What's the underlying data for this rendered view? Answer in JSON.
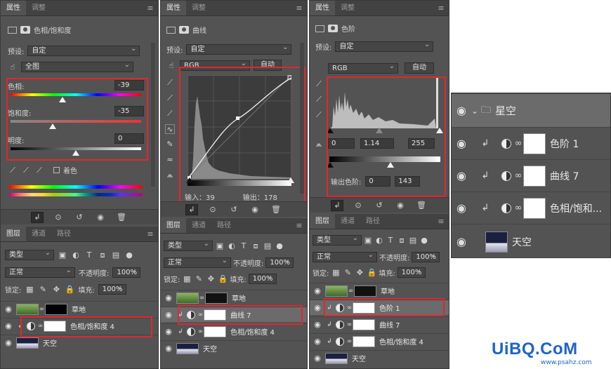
{
  "tabs": {
    "properties": "属性",
    "adjustments": "调整",
    "layers": "图层",
    "channels": "通道",
    "paths": "路径",
    "menu": "≡"
  },
  "p1": {
    "title": "色相/饱和度",
    "preset_label": "预设:",
    "preset_value": "自定",
    "channel_value": "全图",
    "hue_label": "色相:",
    "hue_value": "-39",
    "hue_pos": 0.4,
    "sat_label": "饱和度:",
    "sat_value": "-35",
    "sat_pos": 0.32,
    "light_label": "明度:",
    "light_value": "0",
    "light_pos": 0.5,
    "colorize_label": "着色",
    "layers": {
      "kind": "类型",
      "blend": "正常",
      "opacity_label": "不透明度:",
      "opacity_value": "100%",
      "lock_label": "锁定:",
      "fill_label": "填充:",
      "fill_value": "100%",
      "rows": [
        {
          "name": "草地"
        },
        {
          "name": "色相/饱和度 4"
        },
        {
          "name": "天空"
        }
      ]
    }
  },
  "p2": {
    "title": "曲线",
    "preset_label": "预设:",
    "preset_value": "自定",
    "channel_value": "RGB",
    "auto_label": "自动",
    "input_label": "输入：39",
    "output_label": "输出：178",
    "layers": {
      "kind": "类型",
      "blend": "正常",
      "opacity_label": "不透明度:",
      "opacity_value": "100%",
      "lock_label": "锁定:",
      "fill_label": "填充:",
      "fill_value": "100%",
      "rows": [
        {
          "name": "草地"
        },
        {
          "name": "曲线 7"
        },
        {
          "name": "色相/饱和度 4"
        },
        {
          "name": "天空"
        }
      ]
    }
  },
  "p3": {
    "title": "色阶",
    "preset_label": "预设:",
    "preset_value": "自定",
    "channel_value": "RGB",
    "auto_label": "自动",
    "input_black": "0",
    "input_gamma": "1.14",
    "input_white": "255",
    "output_label": "输出色阶:",
    "output_black": "0",
    "output_white": "143",
    "layers": {
      "kind": "类型",
      "blend": "正常",
      "opacity_label": "不透明度:",
      "opacity_value": "100%",
      "lock_label": "锁定:",
      "fill_label": "填充:",
      "fill_value": "100%",
      "rows": [
        {
          "name": "草地"
        },
        {
          "name": "色阶 1"
        },
        {
          "name": "曲线 7"
        },
        {
          "name": "色相/饱和度 4"
        },
        {
          "name": "天空"
        }
      ]
    }
  },
  "p4": {
    "rows": [
      {
        "name": "星空"
      },
      {
        "name": "色阶 1"
      },
      {
        "name": "曲线 7"
      },
      {
        "name": "色相/饱和..."
      },
      {
        "name": "天空"
      }
    ]
  },
  "watermark": {
    "brand": "UiBQ.CoM",
    "url": "www.psahz.com"
  },
  "colors": {
    "accent_red": "#e0272f",
    "panel_bg": "#535353"
  }
}
